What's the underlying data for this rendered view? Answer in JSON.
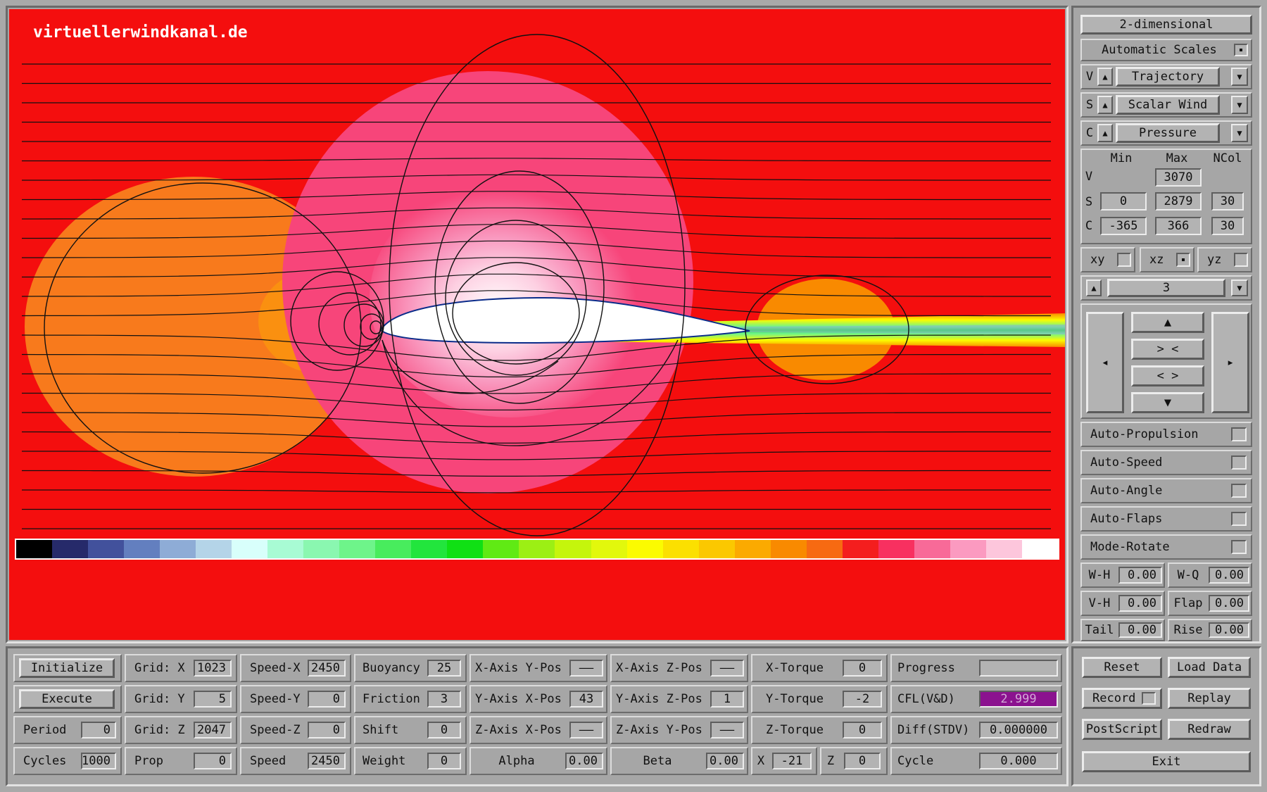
{
  "brand_text": "virtuellerwindkanal.de",
  "colors": {
    "background_field": "#f40e0e",
    "orange_region": "#f87a1c",
    "pink_region": "#f7457a",
    "cfl_highlight": "#8b128f"
  },
  "colorbar": [
    "#000000",
    "#262a6a",
    "#42519c",
    "#637fbf",
    "#8eacd6",
    "#b4d4e8",
    "#d8fffb",
    "#a8fbd4",
    "#8af7b0",
    "#6ef48a",
    "#48ec5d",
    "#22e53d",
    "#10e014",
    "#60ea14",
    "#9cef14",
    "#c5f50c",
    "#e2f80c",
    "#fbfb00",
    "#fbe000",
    "#fbc800",
    "#fbaa00",
    "#f98a00",
    "#f76a12",
    "#f41e1e",
    "#f83060",
    "#f86a98",
    "#fb9ac0",
    "#fdc6dc",
    "#ffffff"
  ],
  "right_panel": {
    "mode_button": "2-dimensional",
    "auto_scales": "Automatic Scales",
    "selectors": [
      {
        "letter": "V",
        "value": "Trajectory"
      },
      {
        "letter": "S",
        "value": "Scalar Wind"
      },
      {
        "letter": "C",
        "value": "Pressure"
      }
    ],
    "scale_headers": {
      "min": "Min",
      "max": "Max",
      "ncol": "NCol"
    },
    "scale_rows": [
      {
        "letter": "V",
        "min": "",
        "max": "3070",
        "ncol": ""
      },
      {
        "letter": "S",
        "min": "0",
        "max": "2879",
        "ncol": "30"
      },
      {
        "letter": "C",
        "min": "-365",
        "max": "366",
        "ncol": "30"
      }
    ],
    "planes": [
      {
        "label": "xy",
        "checked": false
      },
      {
        "label": "xz",
        "checked": true
      },
      {
        "label": "yz",
        "checked": false
      }
    ],
    "slice_value": "3",
    "nav": {
      "left": "◂",
      "right": "▸",
      "up": "▲",
      "contract": "> <",
      "expand": "< >",
      "down": "▼"
    },
    "toggles": [
      "Auto-Propulsion",
      "Auto-Speed",
      "Auto-Angle",
      "Auto-Flaps",
      "Mode-Rotate"
    ],
    "params": [
      [
        {
          "label": "W-H",
          "value": "0.00"
        },
        {
          "label": "W-Q",
          "value": "0.00"
        }
      ],
      [
        {
          "label": "V-H",
          "value": "0.00"
        },
        {
          "label": "Flap",
          "value": "0.00"
        }
      ],
      [
        {
          "label": "Tail",
          "value": "0.00"
        },
        {
          "label": "Rise",
          "value": "0.00"
        }
      ]
    ],
    "arrow_up": "▲",
    "arrow_down": "▼"
  },
  "bottom": {
    "col1": [
      "Initialize",
      "Execute"
    ],
    "period": {
      "label": "Period",
      "value": "0"
    },
    "cycles": {
      "label": "Cycles",
      "value": "1000"
    },
    "grid": [
      {
        "label": "Grid: X",
        "value": "1023"
      },
      {
        "label": "Grid: Y",
        "value": "5"
      },
      {
        "label": "Grid: Z",
        "value": "2047"
      },
      {
        "label": "Prop",
        "value": "0"
      }
    ],
    "speed": [
      {
        "label": "Speed-X",
        "value": "2450"
      },
      {
        "label": "Speed-Y",
        "value": "0"
      },
      {
        "label": "Speed-Z",
        "value": "0"
      },
      {
        "label": "Speed",
        "value": "2450"
      }
    ],
    "phys": [
      {
        "label": "Buoyancy",
        "value": "25"
      },
      {
        "label": "Friction",
        "value": "3"
      },
      {
        "label": "Shift",
        "value": "0"
      },
      {
        "label": "Weight",
        "value": "0"
      }
    ],
    "axis1": [
      {
        "label": "X-Axis Y-Pos",
        "value": "——"
      },
      {
        "label": "Y-Axis X-Pos",
        "value": "43"
      },
      {
        "label": "Z-Axis X-Pos",
        "value": "——"
      },
      {
        "label": "Alpha",
        "value": "0.00"
      }
    ],
    "axis2": [
      {
        "label": "X-Axis Z-Pos",
        "value": "——"
      },
      {
        "label": "Y-Axis Z-Pos",
        "value": "1"
      },
      {
        "label": "Z-Axis Y-Pos",
        "value": "——"
      },
      {
        "label": "Beta",
        "value": "0.00"
      }
    ],
    "torque": [
      {
        "label": "X-Torque",
        "value": "0"
      },
      {
        "label": "Y-Torque",
        "value": "-2"
      },
      {
        "label": "Z-Torque",
        "value": "0"
      }
    ],
    "xz": [
      {
        "label": "X",
        "value": "-21"
      },
      {
        "label": "Z",
        "value": "0"
      }
    ],
    "status": [
      {
        "label": "Progress",
        "value": ""
      },
      {
        "label": "CFL(V&D)",
        "value": "2.999"
      },
      {
        "label": "Diff(STDV)",
        "value": "0.000000"
      },
      {
        "label": "Cycle",
        "value": "0.000"
      }
    ],
    "actions": [
      [
        "Reset",
        "Load Data"
      ],
      [
        "Record",
        "Replay"
      ],
      [
        "PostScript",
        "Redraw"
      ]
    ],
    "exit": "Exit"
  }
}
